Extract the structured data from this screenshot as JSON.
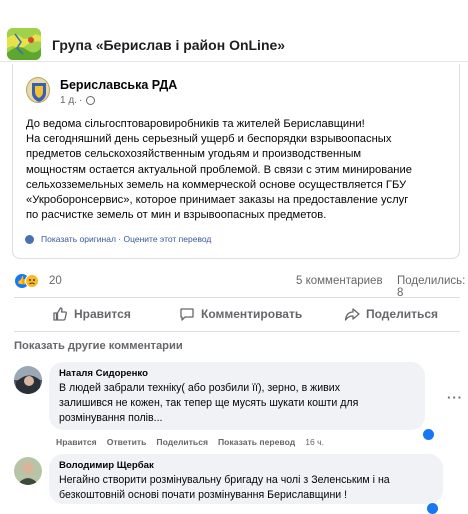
{
  "group": {
    "title": "Група «Берислав і район OnLine»",
    "thumb_icon": "group-map-thumbnail"
  },
  "post": {
    "author": "Бериславська РДА",
    "time": "1 д.",
    "text": [
      "До ведома сільгосптоваровиробників та жителей Бериславщини!",
      "На сегодняшний день серьезный ущерб и беспорядки взрывоопасных",
      "предметов сельскохозяйственным угодьям и производственным",
      "мощностям остается актуальной проблемой. В связи с этим минирование",
      "сельхозземельных земель на коммерческой основе осуществляется ГБУ",
      "«Укроборонсервис», которое принимает заказы на предоставление услуг",
      "по расчистке земель от мин и взрывоопасных предметов."
    ],
    "translate_links": "Показать оригинал · Оцените этот перевод"
  },
  "stats": {
    "reactions_count": "20",
    "comments": "5 комментариев",
    "shares": "Поделились: 8",
    "reaction_colors": {
      "like": "#1877f2",
      "sad": "#f7b928"
    }
  },
  "actions": {
    "like": "Нравится",
    "comment": "Комментировать",
    "share": "Поделиться"
  },
  "show_more_comments": "Показать другие комментарии",
  "comments": [
    {
      "author": "Наталя Сидоренко",
      "lines": [
        "В людей забрали техніку( або розбили її), зерно, в живих",
        "залишився не кожен, так тепер ще мусять шукати кошти для",
        "розмінування полів..."
      ],
      "like": "Нравится",
      "reply": "Ответить",
      "share": "Поделиться",
      "translate": "Показать перевод",
      "time": "16 ч."
    },
    {
      "author": "Володимир Щербак",
      "lines": [
        "Негайно створити розмінувальну бригаду на чолі з Зеленським і на",
        "безкоштовній основі почати розмінування Бериславщини !"
      ]
    }
  ]
}
